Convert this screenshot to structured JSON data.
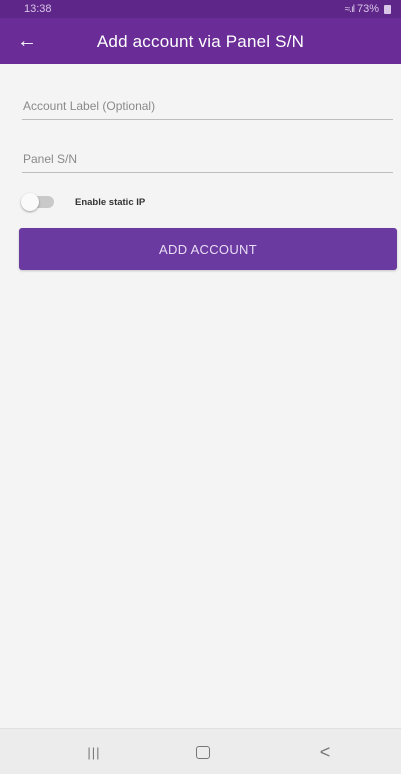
{
  "status_bar": {
    "time": "13:38",
    "battery": "73%",
    "signal_icon": "wifi-signal-icon"
  },
  "header": {
    "title": "Add account via Panel S/N",
    "back_icon": "←"
  },
  "form": {
    "account_label_placeholder": "Account Label (Optional)",
    "account_label_value": "",
    "panel_sn_placeholder": "Panel S/N",
    "panel_sn_value": "",
    "static_ip_label": "Enable static IP",
    "static_ip_enabled": false,
    "submit_label": "ADD ACCOUNT"
  },
  "nav_bar": {
    "recents": "|||",
    "back": "<"
  },
  "colors": {
    "primary": "#6a2c96",
    "button": "#6b3aa0",
    "background": "#f4f4f4"
  }
}
